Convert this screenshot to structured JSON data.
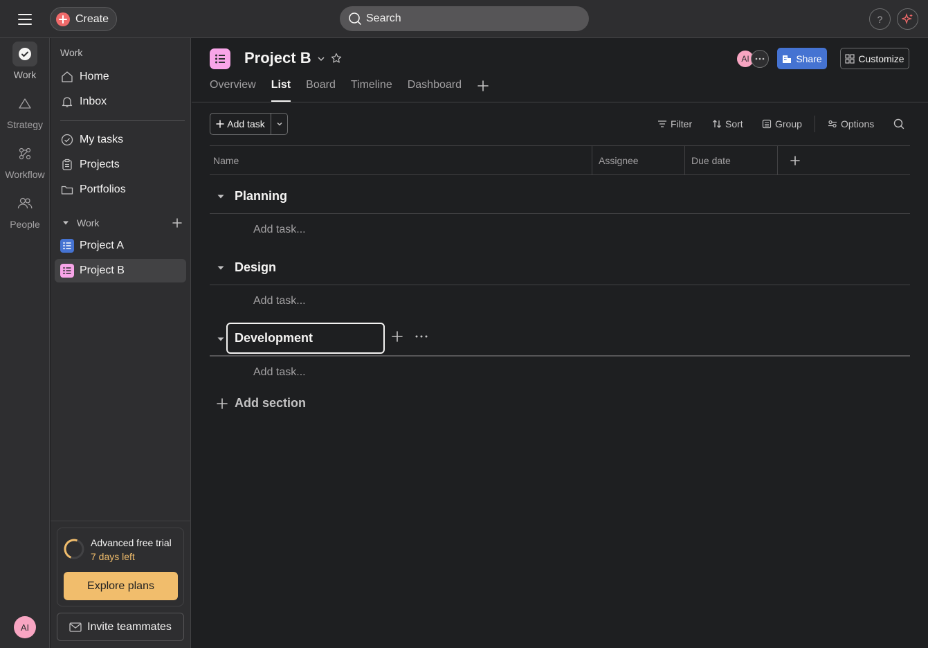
{
  "topbar": {
    "create_label": "Create",
    "search_placeholder": "Search",
    "help_label": "?"
  },
  "rail": {
    "items": [
      {
        "label": "Work"
      },
      {
        "label": "Strategy"
      },
      {
        "label": "Workflow"
      },
      {
        "label": "People"
      }
    ],
    "avatar_initials": "AI"
  },
  "sidebar": {
    "heading": "Work",
    "nav": [
      {
        "label": "Home"
      },
      {
        "label": "Inbox"
      }
    ],
    "nav2": [
      {
        "label": "My tasks"
      },
      {
        "label": "Projects"
      },
      {
        "label": "Portfolios"
      }
    ],
    "team_label": "Work",
    "projects": [
      {
        "label": "Project A",
        "color": "#4573d2"
      },
      {
        "label": "Project B",
        "color": "#f8a5e8"
      }
    ],
    "trial": {
      "title": "Advanced free trial",
      "days_left": "7 days left",
      "explore_label": "Explore plans"
    },
    "invite_label": "Invite teammates"
  },
  "header": {
    "project_title": "Project B",
    "avatar_initials": "AI",
    "share_label": "Share",
    "customize_label": "Customize",
    "tabs": [
      {
        "label": "Overview"
      },
      {
        "label": "List"
      },
      {
        "label": "Board"
      },
      {
        "label": "Timeline"
      },
      {
        "label": "Dashboard"
      }
    ]
  },
  "toolbar": {
    "add_task_label": "Add task",
    "filter_label": "Filter",
    "sort_label": "Sort",
    "group_label": "Group",
    "options_label": "Options"
  },
  "table": {
    "columns": [
      "Name",
      "Assignee",
      "Due date"
    ],
    "sections": [
      {
        "name": "Planning",
        "add_task": "Add task..."
      },
      {
        "name": "Design",
        "add_task": "Add task..."
      },
      {
        "name": "Development",
        "add_task": "Add task..."
      }
    ],
    "add_section_label": "Add section"
  },
  "colors": {
    "accent_blue": "#4573d2",
    "create_red": "#f06a6a",
    "trial_orange": "#f1bd6c",
    "project_pink": "#f8a5e8"
  }
}
